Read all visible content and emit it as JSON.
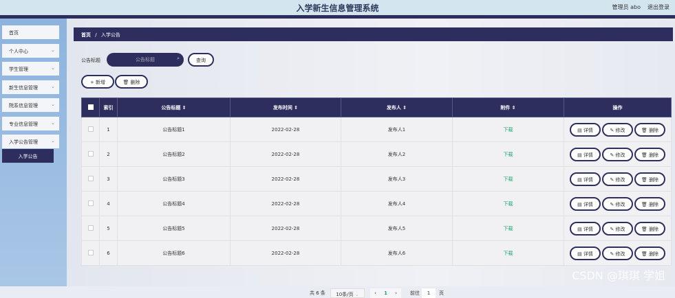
{
  "header": {
    "title": "入学新生信息管理系统",
    "user": "管理员 abo",
    "logout": "退出登录"
  },
  "sidebar": {
    "items": [
      {
        "label": "首页",
        "chev": false
      },
      {
        "label": "个人中心",
        "chev": true
      },
      {
        "label": "学生管理",
        "chev": true
      },
      {
        "label": "新生信息管理",
        "chev": true
      },
      {
        "label": "院系信息管理",
        "chev": true
      },
      {
        "label": "专业信息管理",
        "chev": true
      },
      {
        "label": "入学公告管理",
        "chev": true
      }
    ],
    "sub_item": "入学公告"
  },
  "breadcrumb": {
    "home": "首页",
    "sep": "/",
    "current": "入学公告"
  },
  "search": {
    "label": "公告标题",
    "placeholder": "公告标题",
    "button": "查询"
  },
  "toolbar": {
    "add": "+ 新增",
    "delete": "删除"
  },
  "table": {
    "headers": [
      "索引",
      "公告标题 ⇕",
      "发布时间 ⇕",
      "发布人 ⇕",
      "附件 ⇕",
      "操作"
    ],
    "rows": [
      {
        "index": "1",
        "title": "公告标题1",
        "time": "2022-02-28",
        "publisher": "发布人1",
        "attachment": "下载"
      },
      {
        "index": "2",
        "title": "公告标题2",
        "time": "2022-02-28",
        "publisher": "发布人2",
        "attachment": "下载"
      },
      {
        "index": "3",
        "title": "公告标题3",
        "time": "2022-02-28",
        "publisher": "发布人3",
        "attachment": "下载"
      },
      {
        "index": "4",
        "title": "公告标题4",
        "time": "2022-02-28",
        "publisher": "发布人4",
        "attachment": "下载"
      },
      {
        "index": "5",
        "title": "公告标题5",
        "time": "2022-02-28",
        "publisher": "发布人5",
        "attachment": "下载"
      },
      {
        "index": "6",
        "title": "公告标题6",
        "time": "2022-02-28",
        "publisher": "发布人6",
        "attachment": "下载"
      }
    ],
    "actions": {
      "detail": "详情",
      "edit": "修改",
      "delete": "删除"
    }
  },
  "pagination": {
    "total": "共 6 条",
    "page_size": "10条/页",
    "current_page": "1",
    "goto_label": "前往",
    "goto_value": "1",
    "page_suffix": "页"
  },
  "watermark": "CSDN @琪琪 学姐"
}
